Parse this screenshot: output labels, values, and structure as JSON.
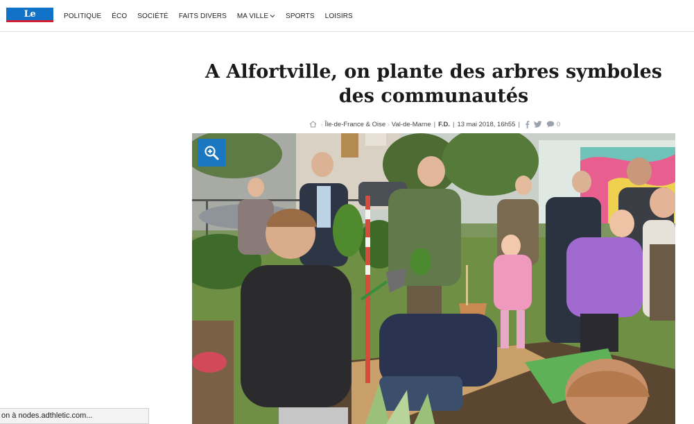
{
  "brand": {
    "logo_text": "Le Parisien",
    "primary": "#1173c7",
    "accent": "#d1202f"
  },
  "nav": {
    "items": [
      {
        "label": "POLITIQUE"
      },
      {
        "label": "ÉCO"
      },
      {
        "label": "SOCIÉTÉ"
      },
      {
        "label": "FAITS DIVERS"
      },
      {
        "label": "MA VILLE",
        "has_dropdown": true
      },
      {
        "label": "SPORTS"
      },
      {
        "label": "LOISIRS"
      }
    ]
  },
  "article": {
    "title": "A Alfortville, on plante des arbres symboles des communautés",
    "breadcrumb": [
      "Île-de-France & Oise",
      "Val-de-Marne"
    ],
    "author": "F.D.",
    "date": "13 mai 2018, 16h55",
    "comment_count": "0",
    "photo": {
      "description_icon": "zoom-in-icon"
    }
  },
  "status_bar": {
    "text": "on à nodes.adthletic.com..."
  }
}
